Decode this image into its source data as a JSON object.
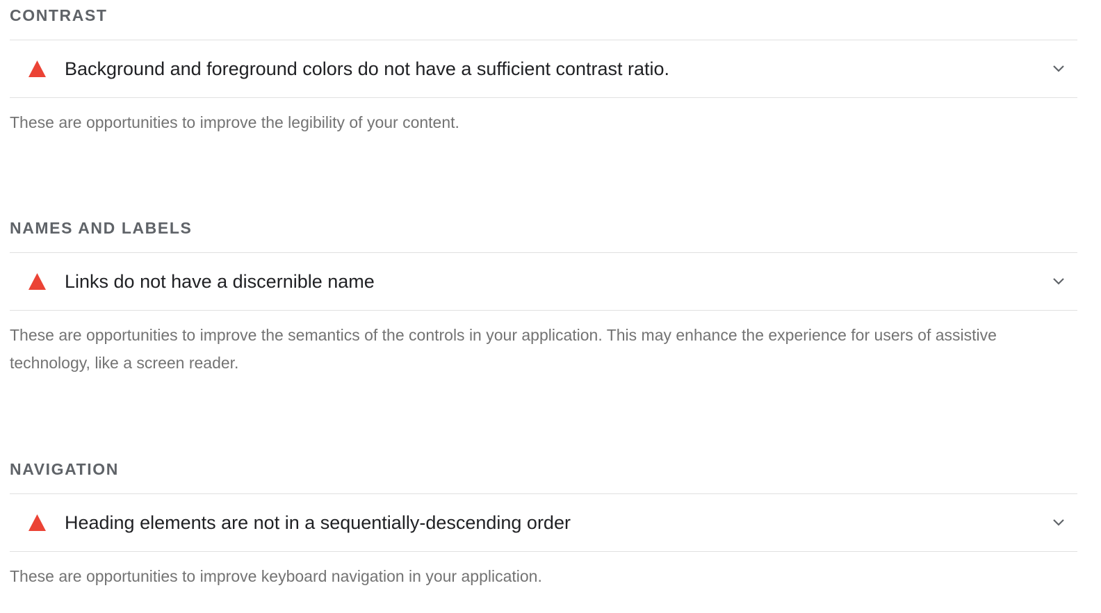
{
  "colors": {
    "fail": "#eb4335",
    "group_title": "#5f6368",
    "description": "#737373",
    "divider": "#e0e0e0"
  },
  "groups": [
    {
      "title": "CONTRAST",
      "audits": [
        {
          "status_icon": "fail-triangle-icon",
          "title": "Background and foreground colors do not have a sufficient contrast ratio.",
          "expand_icon": "chevron-down-icon"
        }
      ],
      "description": "These are opportunities to improve the legibility of your content."
    },
    {
      "title": "NAMES AND LABELS",
      "audits": [
        {
          "status_icon": "fail-triangle-icon",
          "title": "Links do not have a discernible name",
          "expand_icon": "chevron-down-icon"
        }
      ],
      "description": "These are opportunities to improve the semantics of the controls in your application. This may enhance the experience for users of assistive technology, like a screen reader."
    },
    {
      "title": "NAVIGATION",
      "audits": [
        {
          "status_icon": "fail-triangle-icon",
          "title": "Heading elements are not in a sequentially-descending order",
          "expand_icon": "chevron-down-icon"
        }
      ],
      "description": "These are opportunities to improve keyboard navigation in your application."
    }
  ]
}
